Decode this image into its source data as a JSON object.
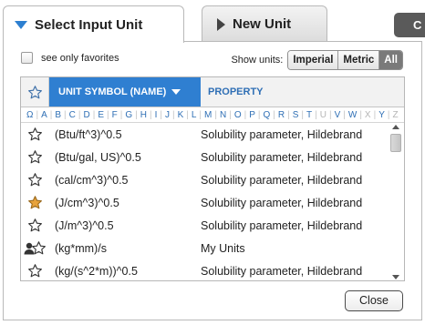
{
  "tabs": [
    {
      "label": "Select Input Unit",
      "active": true
    },
    {
      "label": "New Unit",
      "active": false
    }
  ],
  "corner_button": {
    "label": "C"
  },
  "favorites": {
    "label": "see only favorites",
    "checked": false
  },
  "show_units": {
    "label": "Show units:",
    "options": [
      "Imperial",
      "Metric",
      "All"
    ],
    "selected": "All"
  },
  "table": {
    "col_symbol": "UNIT SYMBOL (NAME)",
    "col_property": "PROPERTY",
    "alphabet": [
      {
        "ch": "Ω",
        "enabled": true
      },
      {
        "ch": "A",
        "enabled": true
      },
      {
        "ch": "B",
        "enabled": true
      },
      {
        "ch": "C",
        "enabled": true
      },
      {
        "ch": "D",
        "enabled": true
      },
      {
        "ch": "E",
        "enabled": true
      },
      {
        "ch": "F",
        "enabled": true
      },
      {
        "ch": "G",
        "enabled": true
      },
      {
        "ch": "H",
        "enabled": true
      },
      {
        "ch": "I",
        "enabled": true
      },
      {
        "ch": "J",
        "enabled": true
      },
      {
        "ch": "K",
        "enabled": true
      },
      {
        "ch": "L",
        "enabled": true
      },
      {
        "ch": "M",
        "enabled": true
      },
      {
        "ch": "N",
        "enabled": true
      },
      {
        "ch": "O",
        "enabled": true
      },
      {
        "ch": "P",
        "enabled": true
      },
      {
        "ch": "Q",
        "enabled": true
      },
      {
        "ch": "R",
        "enabled": true
      },
      {
        "ch": "S",
        "enabled": true
      },
      {
        "ch": "T",
        "enabled": true
      },
      {
        "ch": "U",
        "enabled": false
      },
      {
        "ch": "V",
        "enabled": true
      },
      {
        "ch": "W",
        "enabled": true
      },
      {
        "ch": "X",
        "enabled": false
      },
      {
        "ch": "Y",
        "enabled": true
      },
      {
        "ch": "Z",
        "enabled": false
      }
    ],
    "rows": [
      {
        "symbol": "(Btu/ft^3)^0.5",
        "property": "Solubility parameter, Hildebrand",
        "favorite": false,
        "user": false
      },
      {
        "symbol": "(Btu/gal, US)^0.5",
        "property": "Solubility parameter, Hildebrand",
        "favorite": false,
        "user": false
      },
      {
        "symbol": "(cal/cm^3)^0.5",
        "property": "Solubility parameter, Hildebrand",
        "favorite": false,
        "user": false
      },
      {
        "symbol": "(J/cm^3)^0.5",
        "property": "Solubility parameter, Hildebrand",
        "favorite": true,
        "user": false
      },
      {
        "symbol": "(J/m^3)^0.5",
        "property": "Solubility parameter, Hildebrand",
        "favorite": false,
        "user": false
      },
      {
        "symbol": "(kg*mm)/s",
        "property": "My Units",
        "favorite": false,
        "user": true
      },
      {
        "symbol": "(kg/(s^2*m))^0.5",
        "property": "Solubility parameter, Hildebrand",
        "favorite": false,
        "user": false
      }
    ]
  },
  "close_button": {
    "label": "Close"
  },
  "colors": {
    "accent": "#2f7fd1",
    "favorite_star": "#e8a33c",
    "header_link": "#2f6fb5"
  }
}
